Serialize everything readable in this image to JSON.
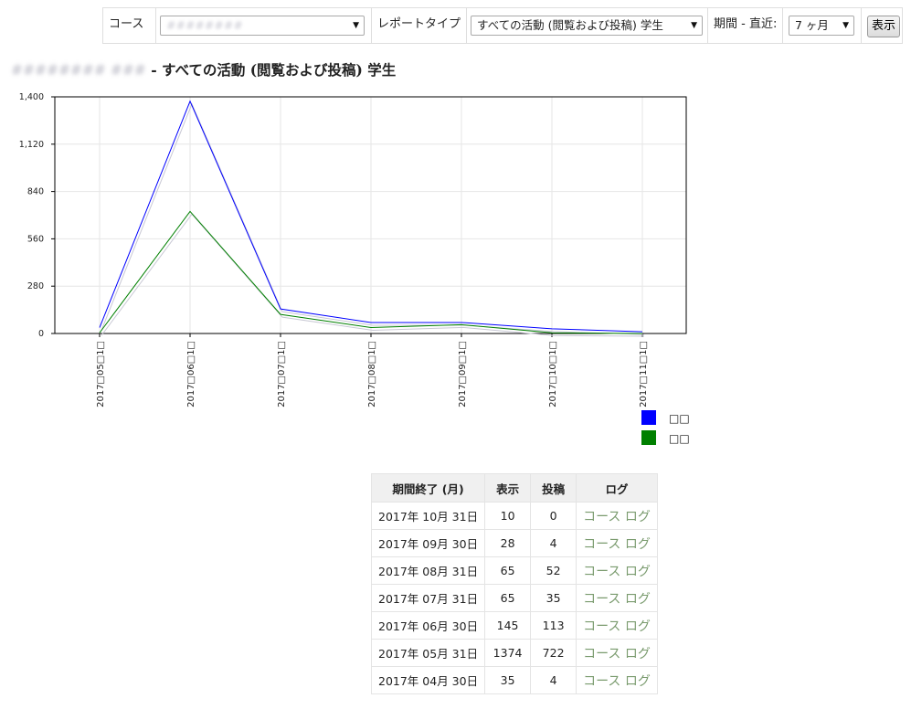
{
  "filters": {
    "course_label": "コース",
    "course_value": "########",
    "report_type_label": "レポートタイプ",
    "report_type_value": "すべての活動 (閲覧および投稿) 学生",
    "period_label": "期間 - 直近:",
    "period_value": "7 ヶ月",
    "show_button": "表示"
  },
  "heading": {
    "course_name": "######## ###",
    "title": " - すべての活動 (閲覧および投稿) 学生"
  },
  "legend": [
    {
      "label": "□□",
      "color": "#0000ff"
    },
    {
      "label": "□□",
      "color": "#008000"
    }
  ],
  "chart_data": {
    "type": "line",
    "categories": [
      "2017□05□1□",
      "2017□06□1□",
      "2017□07□1□",
      "2017□08□1□",
      "2017□09□1□",
      "2017□10□1□",
      "2017□11□1□"
    ],
    "y_ticks": [
      "0",
      "280",
      "560",
      "840",
      "1,120",
      "1,400"
    ],
    "ylim": [
      0,
      1400
    ],
    "grid": true,
    "legend_position": "bottom-right",
    "series": [
      {
        "name": "□□",
        "color": "#0000ff",
        "values": [
          35,
          1374,
          145,
          65,
          65,
          28,
          10
        ]
      },
      {
        "name": "□□",
        "color": "#008000",
        "values": [
          4,
          722,
          113,
          35,
          52,
          4,
          0
        ]
      }
    ]
  },
  "table": {
    "headers": [
      "期間終了 (月)",
      "表示",
      "投稿",
      "ログ"
    ],
    "rows": [
      {
        "date": "2017年 10月 31日",
        "views": "10",
        "posts": "0",
        "log": "コース ログ"
      },
      {
        "date": "2017年 09月 30日",
        "views": "28",
        "posts": "4",
        "log": "コース ログ"
      },
      {
        "date": "2017年 08月 31日",
        "views": "65",
        "posts": "52",
        "log": "コース ログ"
      },
      {
        "date": "2017年 07月 31日",
        "views": "65",
        "posts": "35",
        "log": "コース ログ"
      },
      {
        "date": "2017年 06月 30日",
        "views": "145",
        "posts": "113",
        "log": "コース ログ"
      },
      {
        "date": "2017年 05月 31日",
        "views": "1374",
        "posts": "722",
        "log": "コース ログ"
      },
      {
        "date": "2017年 04月 30日",
        "views": "35",
        "posts": "4",
        "log": "コース ログ"
      }
    ]
  }
}
